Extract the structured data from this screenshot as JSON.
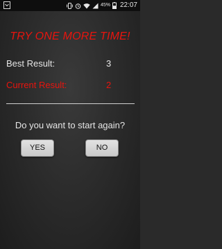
{
  "status_bar": {
    "notification_icon": "notification-icon",
    "battery_percent": "45%",
    "time": "22:07"
  },
  "game": {
    "title": "TRY ONE MORE TIME!",
    "best_label": "Best Result:",
    "best_value": "3",
    "current_label": "Current Result:",
    "current_value": "2",
    "question": "Do you want to start again?",
    "yes_label": "YES",
    "no_label": "NO"
  },
  "colors": {
    "accent_red": "#e8140e",
    "text": "#e6e6e6",
    "button_bg": "#d6d6d6"
  }
}
